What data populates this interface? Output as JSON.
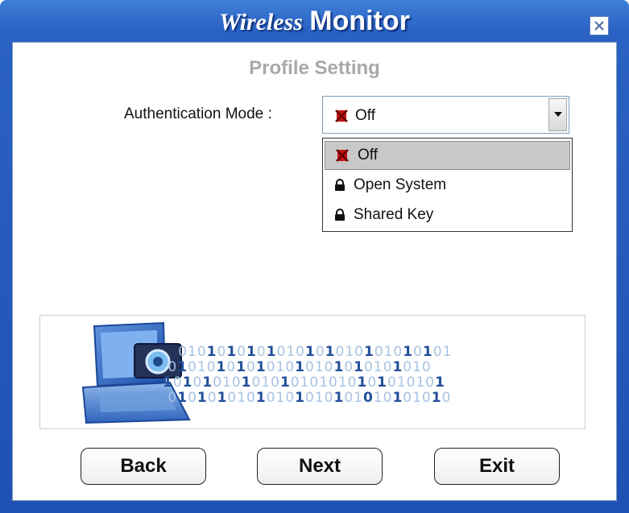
{
  "window": {
    "title_part1": "Wireless",
    "title_part2": "Monitor",
    "close_icon": "close-icon"
  },
  "page": {
    "subtitle": "Profile Setting"
  },
  "authentication": {
    "label": "Authentication Mode :",
    "selected": "Off",
    "options": [
      {
        "label": "Off",
        "icon": "no-security-icon",
        "selected": true
      },
      {
        "label": "Open System",
        "icon": "lock-icon",
        "selected": false
      },
      {
        "label": "Shared Key",
        "icon": "lock-icon",
        "selected": false
      }
    ]
  },
  "banner": {
    "image": "laptop-binary-illustration"
  },
  "buttons": {
    "back": "Back",
    "next": "Next",
    "exit": "Exit"
  },
  "colors": {
    "title_bar": "#1f52b2",
    "subtitle": "#a9a9a9",
    "selection": "#c8c8c8",
    "no_security_icon": "#d11a1a"
  }
}
